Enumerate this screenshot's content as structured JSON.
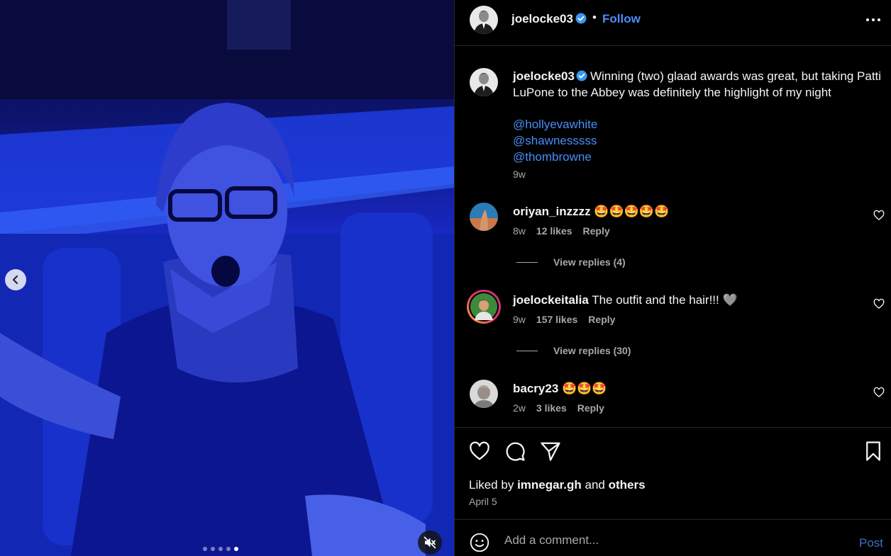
{
  "post": {
    "author": "joelocke03",
    "follow_label": "Follow",
    "separator": "•",
    "caption_text": "Winning (two) glaad awards was great, but taking Patti LuPone to the Abbey was definitely the highlight of my night",
    "mentions": [
      "@hollyevawhite",
      "@shawnesssss",
      "@thombrowne"
    ],
    "caption_time": "9w",
    "liked_by_prefix": "Liked by",
    "liked_by_user": "imnegar.gh",
    "liked_by_and": "and",
    "liked_by_others": "others",
    "date": "April 5"
  },
  "media": {
    "carousel_count": 5,
    "active_index": 4
  },
  "comments": [
    {
      "user": "oriyan_inzzzz",
      "text": "🤩🤩🤩🤩🤩",
      "time": "8w",
      "likes": "12 likes",
      "reply": "Reply",
      "view_replies": "View replies (4)"
    },
    {
      "user": "joelockeitalia",
      "text": "The outfit and the hair!!! 🩶",
      "time": "9w",
      "likes": "157 likes",
      "reply": "Reply",
      "view_replies": "View replies (30)"
    },
    {
      "user": "bacry23",
      "text": "🤩🤩🤩",
      "time": "2w",
      "likes": "3 likes",
      "reply": "Reply"
    }
  ],
  "composer": {
    "placeholder": "Add a comment...",
    "post_label": "Post"
  },
  "colors": {
    "link_blue": "#4a8df6",
    "verified_blue": "#3797f0",
    "muted_text": "#a8a8a8",
    "divider": "#262626"
  },
  "icons": [
    "chevron-left-icon",
    "mute-icon",
    "verified-icon",
    "more-icon",
    "heart-icon",
    "comment-icon",
    "share-icon",
    "bookmark-icon",
    "emoji-icon"
  ]
}
